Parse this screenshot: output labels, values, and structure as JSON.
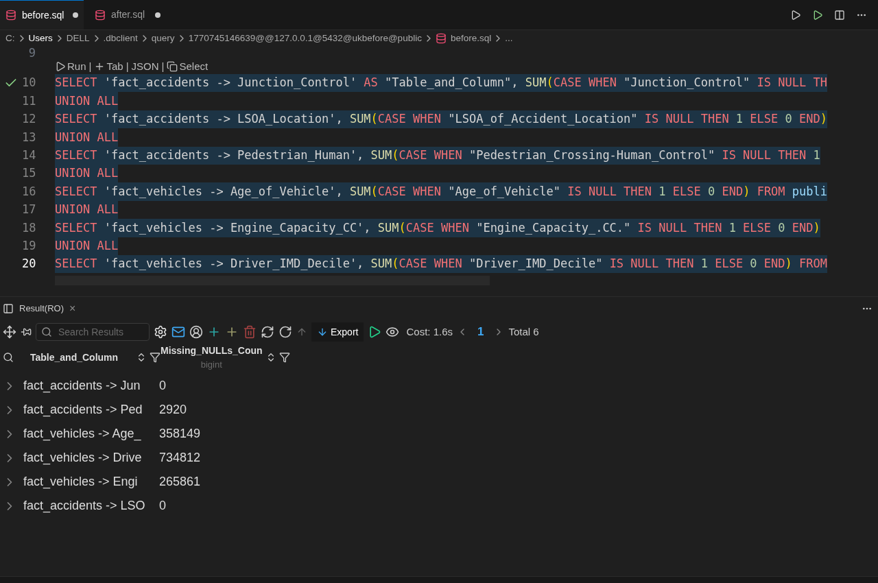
{
  "tabs": [
    {
      "label": "before.sql",
      "selected": true,
      "dirty": true
    },
    {
      "label": "after.sql",
      "selected": false,
      "dirty": true
    }
  ],
  "breadcrumb": [
    "C:",
    "Users",
    "DELL",
    ".dbclient",
    "query",
    "1770745146639@@127.0.0.1@5432@ukbefore@public",
    "before.sql",
    "..."
  ],
  "codelens": [
    {
      "kind": "run",
      "label": "Run"
    },
    {
      "kind": "separator",
      "label": "|"
    },
    {
      "kind": "tab",
      "label": "Tab"
    },
    {
      "kind": "separator",
      "label": "|"
    },
    {
      "kind": "plain",
      "label": "JSON"
    },
    {
      "kind": "separator",
      "label": "|"
    },
    {
      "kind": "copy",
      "label": "Select"
    }
  ],
  "partial_line_number": "9",
  "lines": [
    {
      "number": "10",
      "selected": true,
      "check": true,
      "current": false,
      "tokens": [
        {
          "text": "SELECT ",
          "kind": "keyword"
        },
        {
          "text": "'fact_accidents -> Junction_Control' ",
          "kind": "string"
        },
        {
          "text": "AS ",
          "kind": "keyword"
        },
        {
          "text": "\"Table_and_Column\", ",
          "kind": "string"
        },
        {
          "text": "SUM",
          "kind": "func"
        },
        {
          "text": "(",
          "kind": "paren"
        },
        {
          "text": "CASE WHEN ",
          "kind": "keyword"
        },
        {
          "text": "\"Junction_Control\" ",
          "kind": "string"
        },
        {
          "text": "IS NULL TH",
          "kind": "keyword"
        }
      ]
    },
    {
      "number": "11",
      "selected": true,
      "check": false,
      "current": false,
      "tokens": [
        {
          "text": "UNION ALL",
          "kind": "keyword"
        }
      ]
    },
    {
      "number": "12",
      "selected": true,
      "check": false,
      "current": false,
      "tokens": [
        {
          "text": "SELECT ",
          "kind": "keyword"
        },
        {
          "text": "'fact_accidents -> LSOA_Location', ",
          "kind": "string"
        },
        {
          "text": "SUM",
          "kind": "func"
        },
        {
          "text": "(",
          "kind": "paren"
        },
        {
          "text": "CASE WHEN ",
          "kind": "keyword"
        },
        {
          "text": "\"LSOA_of_Accident_Location\" ",
          "kind": "string"
        },
        {
          "text": "IS NULL THEN ",
          "kind": "keyword"
        },
        {
          "text": "1 ",
          "kind": "number"
        },
        {
          "text": "ELSE ",
          "kind": "keyword"
        },
        {
          "text": "0 ",
          "kind": "number"
        },
        {
          "text": "END",
          "kind": "keyword"
        },
        {
          "text": ")",
          "kind": "paren"
        }
      ]
    },
    {
      "number": "13",
      "selected": true,
      "check": false,
      "current": false,
      "tokens": [
        {
          "text": "UNION ALL",
          "kind": "keyword"
        }
      ]
    },
    {
      "number": "14",
      "selected": true,
      "check": false,
      "current": false,
      "tokens": [
        {
          "text": "SELECT ",
          "kind": "keyword"
        },
        {
          "text": "'fact_accidents -> Pedestrian_Human', ",
          "kind": "string"
        },
        {
          "text": "SUM",
          "kind": "func"
        },
        {
          "text": "(",
          "kind": "paren"
        },
        {
          "text": "CASE WHEN ",
          "kind": "keyword"
        },
        {
          "text": "\"Pedestrian_Crossing-Human_Control\" ",
          "kind": "string"
        },
        {
          "text": "IS NULL THEN ",
          "kind": "keyword"
        },
        {
          "text": "1",
          "kind": "number"
        }
      ]
    },
    {
      "number": "15",
      "selected": true,
      "check": false,
      "current": false,
      "tokens": [
        {
          "text": "UNION ALL",
          "kind": "keyword"
        }
      ]
    },
    {
      "number": "16",
      "selected": true,
      "check": false,
      "current": false,
      "tokens": [
        {
          "text": "SELECT ",
          "kind": "keyword"
        },
        {
          "text": "'fact_vehicles -> Age_of_Vehicle', ",
          "kind": "string"
        },
        {
          "text": "SUM",
          "kind": "func"
        },
        {
          "text": "(",
          "kind": "paren"
        },
        {
          "text": "CASE WHEN ",
          "kind": "keyword"
        },
        {
          "text": "\"Age_of_Vehicle\" ",
          "kind": "string"
        },
        {
          "text": "IS NULL THEN ",
          "kind": "keyword"
        },
        {
          "text": "1 ",
          "kind": "number"
        },
        {
          "text": "ELSE ",
          "kind": "keyword"
        },
        {
          "text": "0 ",
          "kind": "number"
        },
        {
          "text": "END",
          "kind": "keyword"
        },
        {
          "text": ") ",
          "kind": "paren"
        },
        {
          "text": "FROM ",
          "kind": "keyword"
        },
        {
          "text": "publi",
          "kind": "plain"
        }
      ]
    },
    {
      "number": "17",
      "selected": true,
      "check": false,
      "current": false,
      "tokens": [
        {
          "text": "UNION ALL",
          "kind": "keyword"
        }
      ]
    },
    {
      "number": "18",
      "selected": true,
      "check": false,
      "current": false,
      "tokens": [
        {
          "text": "SELECT ",
          "kind": "keyword"
        },
        {
          "text": "'fact_vehicles -> Engine_Capacity_CC', ",
          "kind": "string"
        },
        {
          "text": "SUM",
          "kind": "func"
        },
        {
          "text": "(",
          "kind": "paren"
        },
        {
          "text": "CASE WHEN ",
          "kind": "keyword"
        },
        {
          "text": "\"Engine_Capacity_.CC.\" ",
          "kind": "string"
        },
        {
          "text": "IS NULL THEN ",
          "kind": "keyword"
        },
        {
          "text": "1 ",
          "kind": "number"
        },
        {
          "text": "ELSE ",
          "kind": "keyword"
        },
        {
          "text": "0 ",
          "kind": "number"
        },
        {
          "text": "END",
          "kind": "keyword"
        },
        {
          "text": ")",
          "kind": "paren"
        }
      ]
    },
    {
      "number": "19",
      "selected": true,
      "check": false,
      "current": false,
      "tokens": [
        {
          "text": "UNION ALL",
          "kind": "keyword"
        }
      ]
    },
    {
      "number": "20",
      "selected": true,
      "check": false,
      "current": true,
      "tokens": [
        {
          "text": "SELECT ",
          "kind": "keyword"
        },
        {
          "text": "'fact_vehicles -> Driver_IMD_Decile', ",
          "kind": "string"
        },
        {
          "text": "SUM",
          "kind": "func"
        },
        {
          "text": "(",
          "kind": "paren"
        },
        {
          "text": "CASE WHEN ",
          "kind": "keyword"
        },
        {
          "text": "\"Driver_IMD_Decile\" ",
          "kind": "string"
        },
        {
          "text": "IS NULL THEN ",
          "kind": "keyword"
        },
        {
          "text": "1 ",
          "kind": "number"
        },
        {
          "text": "ELSE ",
          "kind": "keyword"
        },
        {
          "text": "0 ",
          "kind": "number"
        },
        {
          "text": "END",
          "kind": "keyword"
        },
        {
          "text": ") ",
          "kind": "paren"
        },
        {
          "text": "FROM",
          "kind": "keyword"
        }
      ]
    }
  ],
  "result_panel": {
    "tab": {
      "label": "Result(RO)",
      "close": "×"
    },
    "search": {
      "placeholder": "Search Results"
    },
    "export": "Export",
    "cost": "Cost: 1.6s",
    "page": "1",
    "total": "Total 6",
    "columns": [
      {
        "name": "Table_and_Column"
      },
      {
        "name": "Missing_NULLs_Coun",
        "type": "bigint"
      }
    ],
    "rows": [
      {
        "cells": [
          "fact_accidents -> Jun",
          "0"
        ]
      },
      {
        "cells": [
          "fact_accidents -> Ped",
          "2920"
        ]
      },
      {
        "cells": [
          "fact_vehicles -> Age_",
          "358149"
        ]
      },
      {
        "cells": [
          "fact_vehicles -> Drive",
          "734812"
        ]
      },
      {
        "cells": [
          "fact_vehicles -> Engi",
          "265861"
        ]
      },
      {
        "cells": [
          "fact_accidents -> LSO",
          "0"
        ]
      }
    ]
  }
}
